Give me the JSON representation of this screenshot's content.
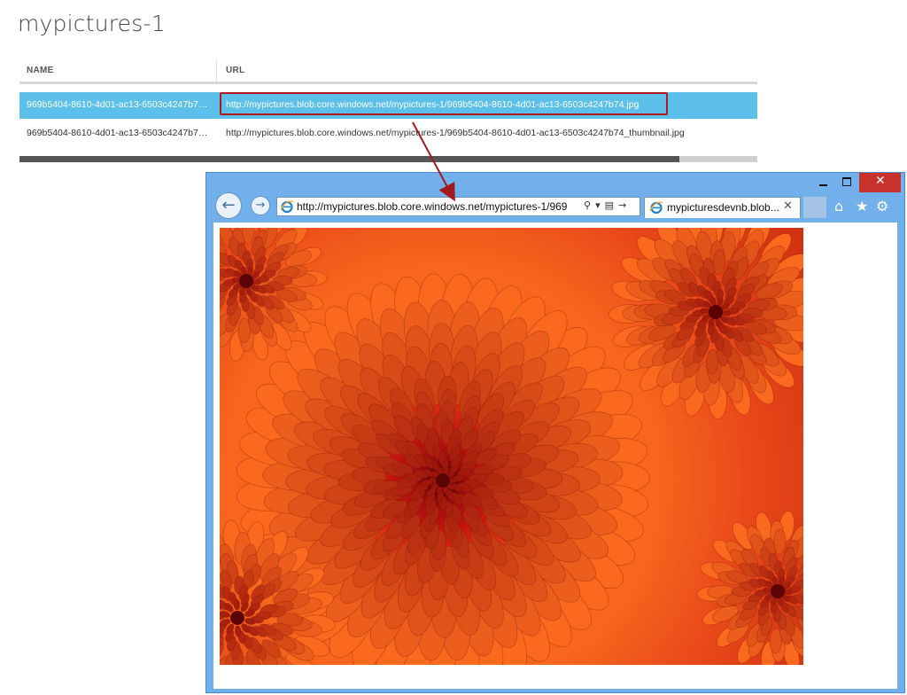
{
  "page": {
    "title": "mypictures-1"
  },
  "table": {
    "columns": {
      "name": "NAME",
      "url": "URL"
    },
    "rows": [
      {
        "name": "969b5404-8610-4d01-ac13-6503c4247b7…",
        "url": "http://mypictures.blob.core.windows.net/mypictures-1/969b5404-8610-4d01-ac13-6503c4247b74.jpg",
        "selected": true
      },
      {
        "name": "969b5404-8610-4d01-ac13-6503c4247b7…",
        "url": "http://mypictures.blob.core.windows.net/mypictures-1/969b5404-8610-4d01-ac13-6503c4247b74_thumbnail.jpg",
        "selected": false
      }
    ],
    "scroll_position": 0.89
  },
  "browser": {
    "window_controls": {
      "minimize": "–",
      "maximize": "□",
      "close": "✕"
    },
    "address": "http://mypictures.blob.core.windows.net/mypictures-1/969",
    "address_icons": [
      "search-icon",
      "dropdown-icon",
      "compatibility-icon",
      "go-icon"
    ],
    "tab": {
      "label": "mypicturesdevnb.blob....",
      "close": "✕"
    },
    "toolbar": [
      "home-icon",
      "favorites-icon",
      "gear-icon"
    ],
    "image": "orange chrysanthemum flower"
  },
  "colors": {
    "selected_row": "#5cc0eb",
    "highlight_border": "#b0181e",
    "window_chrome": "#72b0ec",
    "close_button": "#c8312c"
  }
}
